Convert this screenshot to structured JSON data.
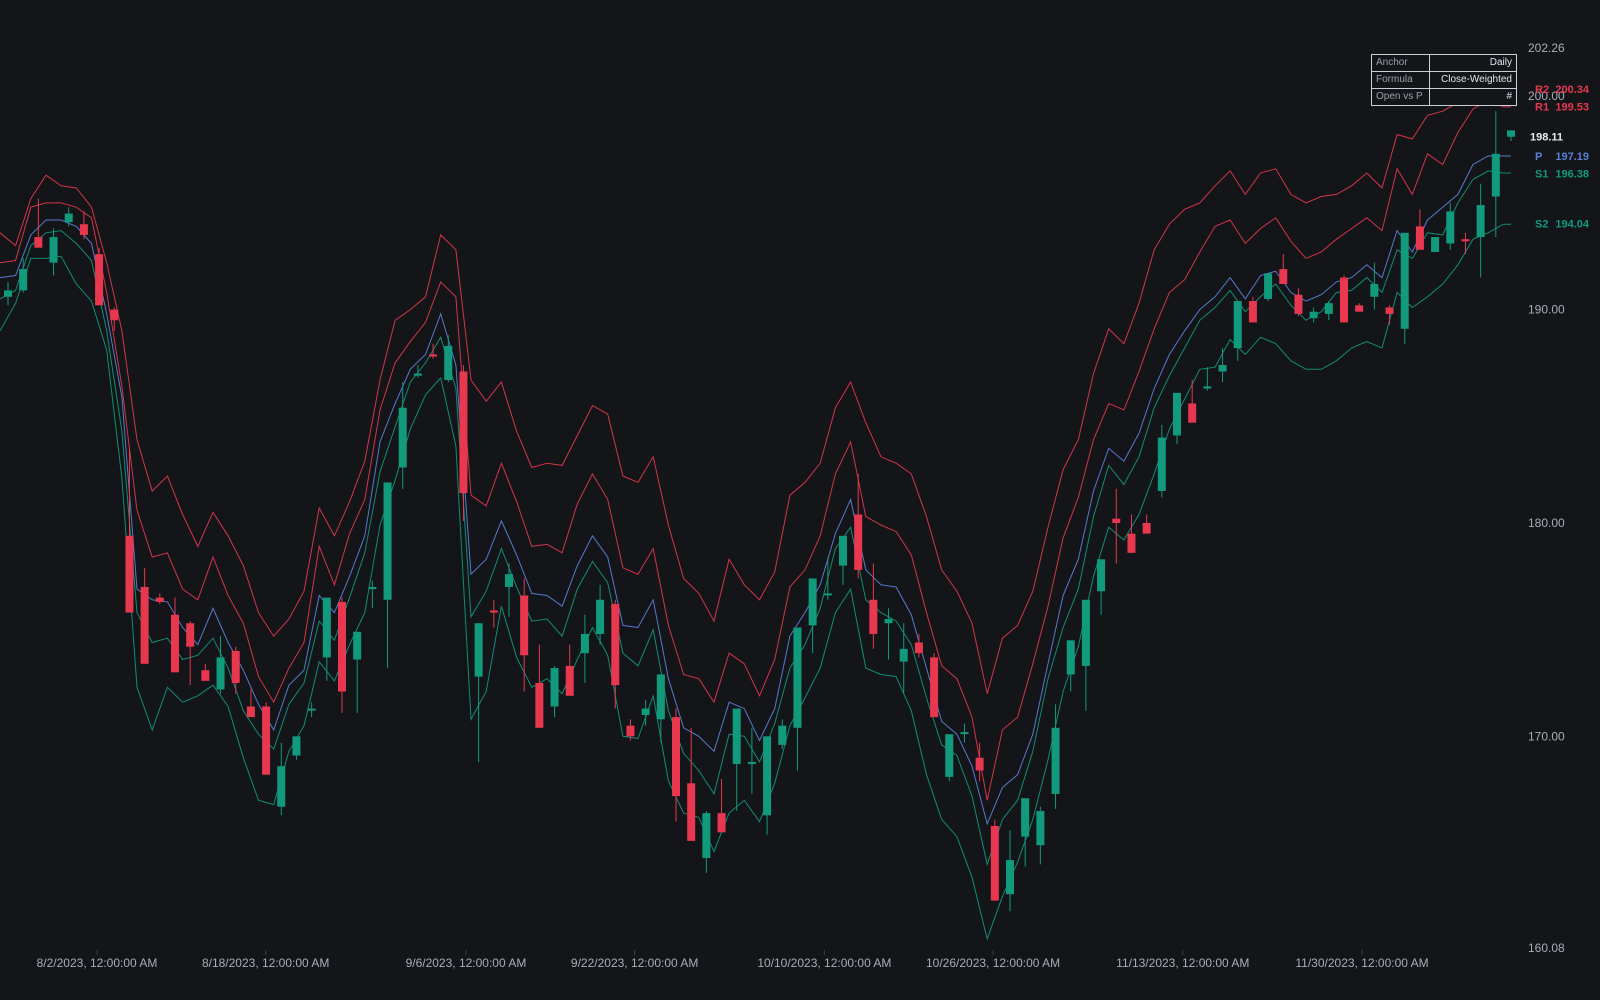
{
  "chart_data": {
    "type": "candlestick",
    "title": "",
    "y_range": [
      160.08,
      202.26
    ],
    "y_ticks": [
      "202.26",
      "200.00",
      "190.00",
      "180.00",
      "170.00",
      "160.08"
    ],
    "x_ticks": [
      {
        "date": "2023-08-02",
        "label": "8/2/2023, 12:00:00 AM"
      },
      {
        "date": "2023-08-18",
        "label": "8/18/2023, 12:00:00 AM"
      },
      {
        "date": "2023-09-06",
        "label": "9/6/2023, 12:00:00 AM"
      },
      {
        "date": "2023-09-22",
        "label": "9/22/2023, 12:00:00 AM"
      },
      {
        "date": "2023-10-10",
        "label": "10/10/2023, 12:00:00 AM"
      },
      {
        "date": "2023-10-26",
        "label": "10/26/2023, 12:00:00 AM"
      },
      {
        "date": "2023-11-13",
        "label": "11/13/2023, 12:00:00 AM"
      },
      {
        "date": "2023-11-30",
        "label": "11/30/2023, 12:00:00 AM"
      }
    ],
    "last_price": "198.11",
    "levels": [
      {
        "name": "R2",
        "value": "200.34",
        "color": "#e8384f"
      },
      {
        "name": "R1",
        "value": "199.53",
        "color": "#e8384f"
      },
      {
        "name": "P",
        "value": "197.19",
        "color": "#5b7fd6"
      },
      {
        "name": "S1",
        "value": "196.38",
        "color": "#129a7d"
      },
      {
        "name": "S2",
        "value": "194.04",
        "color": "#129a7d"
      }
    ],
    "colors": {
      "up": "#129a7d",
      "down": "#e8384f",
      "pivot": "#5b7fd6",
      "resistance": "#e8384f",
      "support": "#129a7d",
      "background": "#131519"
    },
    "candles_ohlc": [
      [
        190.6,
        191.3,
        190.2,
        190.9
      ],
      [
        190.9,
        192.4,
        190.8,
        191.9
      ],
      [
        193.4,
        195.2,
        193.0,
        192.9
      ],
      [
        192.2,
        193.8,
        191.6,
        193.4
      ],
      [
        194.1,
        194.8,
        193.9,
        194.5
      ],
      [
        194.0,
        194.6,
        193.3,
        193.5
      ],
      [
        192.6,
        192.9,
        190.4,
        190.2
      ],
      [
        190.0,
        190.1,
        189.0,
        189.5
      ],
      [
        179.4,
        183.5,
        178.7,
        175.8
      ],
      [
        177.0,
        177.9,
        173.4,
        173.4
      ],
      [
        176.5,
        176.7,
        176.2,
        176.3
      ],
      [
        175.7,
        176.5,
        174.2,
        173.0
      ],
      [
        175.3,
        175.4,
        172.4,
        174.2
      ],
      [
        173.1,
        173.4,
        172.6,
        172.6
      ],
      [
        172.2,
        174.7,
        172.0,
        173.7
      ],
      [
        174.0,
        174.2,
        172.0,
        172.5
      ],
      [
        171.4,
        172.2,
        171.3,
        170.9
      ],
      [
        171.4,
        171.6,
        168.2,
        168.2
      ],
      [
        166.7,
        169.7,
        166.3,
        168.6
      ],
      [
        169.1,
        169.8,
        168.9,
        170.0
      ],
      [
        171.3,
        171.6,
        170.9,
        171.3
      ],
      [
        173.7,
        176.5,
        172.6,
        176.5
      ],
      [
        176.3,
        176.5,
        171.1,
        172.1
      ],
      [
        173.6,
        174.8,
        171.1,
        174.9
      ],
      [
        176.9,
        177.3,
        176.0,
        177.0
      ],
      [
        176.4,
        181.2,
        173.2,
        181.9
      ],
      [
        182.6,
        186.6,
        181.6,
        185.4
      ],
      [
        186.9,
        187.4,
        186.8,
        187.0
      ],
      [
        187.9,
        188.4,
        187.7,
        187.8
      ],
      [
        186.7,
        188.8,
        186.6,
        188.3
      ],
      [
        187.1,
        187.4,
        180.1,
        181.4
      ],
      [
        172.8,
        175.3,
        168.8,
        175.3
      ],
      [
        175.9,
        176.4,
        175.1,
        175.8
      ],
      [
        177.0,
        178.1,
        175.6,
        177.6
      ],
      [
        176.6,
        177.4,
        172.1,
        173.8
      ],
      [
        172.5,
        174.3,
        170.4,
        170.4
      ],
      [
        171.4,
        173.3,
        170.9,
        173.2
      ],
      [
        173.3,
        174.3,
        172.0,
        171.9
      ],
      [
        173.9,
        175.7,
        172.5,
        174.8
      ],
      [
        174.8,
        177.1,
        174.3,
        176.4
      ],
      [
        176.2,
        176.4,
        171.3,
        172.4
      ],
      [
        170.5,
        170.8,
        169.8,
        170.0
      ],
      [
        171.0,
        171.7,
        170.5,
        171.3
      ],
      [
        170.8,
        172.9,
        169.7,
        172.9
      ],
      [
        170.9,
        171.3,
        166.0,
        167.2
      ],
      [
        167.8,
        170.4,
        165.3,
        165.1
      ],
      [
        164.3,
        166.5,
        163.6,
        166.4
      ],
      [
        166.4,
        168.0,
        165.5,
        165.5
      ],
      [
        168.7,
        170.2,
        166.5,
        171.3
      ],
      [
        168.7,
        170.4,
        167.3,
        168.8
      ],
      [
        166.3,
        169.3,
        165.4,
        170.0
      ],
      [
        169.6,
        170.8,
        169.4,
        170.5
      ],
      [
        170.4,
        174.9,
        168.4,
        175.1
      ],
      [
        175.2,
        176.0,
        173.9,
        177.4
      ],
      [
        176.7,
        178.4,
        176.4,
        176.7
      ],
      [
        178.0,
        178.7,
        177.1,
        179.4
      ],
      [
        180.4,
        182.3,
        177.4,
        177.8
      ],
      [
        176.4,
        178.1,
        174.1,
        174.8
      ],
      [
        175.3,
        176.0,
        173.6,
        175.5
      ],
      [
        173.5,
        175.3,
        172.0,
        174.1
      ],
      [
        174.4,
        174.8,
        173.7,
        173.9
      ],
      [
        173.7,
        173.9,
        171.3,
        170.9
      ],
      [
        168.1,
        169.9,
        167.9,
        170.1
      ],
      [
        170.2,
        170.6,
        169.7,
        170.2
      ],
      [
        169.0,
        169.7,
        167.9,
        168.4
      ],
      [
        165.8,
        166.1,
        162.9,
        162.3
      ],
      [
        162.6,
        165.6,
        161.8,
        164.2
      ],
      [
        165.3,
        165.5,
        163.9,
        167.1
      ],
      [
        164.9,
        166.7,
        164.0,
        166.5
      ],
      [
        167.3,
        171.5,
        166.6,
        170.4
      ],
      [
        172.9,
        173.5,
        172.1,
        174.5
      ],
      [
        173.3,
        174.6,
        171.2,
        176.4
      ],
      [
        176.8,
        177.3,
        175.7,
        178.3
      ],
      [
        180.2,
        181.6,
        178.1,
        180.0
      ],
      [
        179.5,
        180.4,
        179.0,
        178.6
      ],
      [
        180.0,
        180.4,
        179.7,
        179.5
      ],
      [
        181.5,
        184.6,
        181.2,
        184.0
      ],
      [
        184.1,
        185.5,
        183.7,
        186.1
      ],
      [
        185.6,
        186.7,
        184.8,
        184.7
      ],
      [
        186.3,
        187.3,
        186.2,
        186.4
      ],
      [
        187.1,
        188.2,
        186.6,
        187.4
      ],
      [
        188.2,
        190.0,
        187.6,
        190.4
      ],
      [
        190.4,
        190.6,
        189.6,
        189.4
      ],
      [
        190.5,
        191.5,
        190.4,
        191.7
      ],
      [
        191.9,
        192.6,
        191.4,
        191.2
      ],
      [
        190.7,
        191.0,
        189.7,
        189.8
      ],
      [
        189.6,
        190.1,
        189.4,
        189.9
      ],
      [
        189.8,
        190.4,
        189.5,
        190.3
      ],
      [
        191.5,
        191.6,
        189.4,
        189.4
      ],
      [
        190.2,
        190.3,
        190.0,
        189.9
      ],
      [
        190.6,
        192.2,
        190.0,
        191.2
      ],
      [
        190.1,
        190.2,
        189.3,
        189.8
      ],
      [
        189.1,
        192.9,
        188.4,
        193.6
      ],
      [
        193.9,
        194.7,
        193.3,
        192.8
      ],
      [
        192.7,
        193.2,
        192.9,
        193.4
      ],
      [
        193.1,
        195.0,
        192.8,
        194.6
      ],
      [
        193.3,
        193.6,
        192.6,
        193.2
      ],
      [
        193.4,
        195.9,
        191.5,
        194.9
      ],
      [
        195.3,
        199.3,
        193.4,
        197.3
      ],
      [
        198.1,
        198.4,
        197.9,
        198.4
      ]
    ],
    "pivot_series": {
      "R2": [
        193.6,
        193.0,
        195.2,
        196.3,
        195.8,
        195.7,
        194.8,
        192.2,
        189.0,
        183.9,
        181.5,
        182.2,
        180.4,
        178.9,
        180.5,
        179.4,
        178.0,
        175.8,
        174.7,
        175.5,
        176.8,
        180.7,
        179.4,
        181.0,
        182.9,
        186.7,
        189.5,
        190.0,
        190.6,
        193.5,
        192.8,
        186.7,
        185.7,
        186.6,
        184.3,
        182.6,
        182.8,
        182.7,
        184.1,
        185.5,
        185.1,
        182.2,
        181.9,
        183.1,
        179.9,
        177.4,
        176.7,
        175.4,
        178.3,
        177.1,
        176.4,
        177.7,
        181.3,
        181.9,
        182.8,
        185.4,
        186.6,
        184.7,
        183.1,
        182.8,
        182.3,
        180.3,
        177.8,
        176.8,
        175.3,
        172.0,
        174.6,
        175.2,
        176.8,
        179.8,
        182.5,
        183.9,
        187.0,
        189.1,
        188.4,
        190.3,
        192.8,
        194.0,
        194.7,
        195.0,
        195.8,
        196.5,
        195.4,
        196.4,
        196.6,
        195.4,
        195.0,
        195.3,
        195.4,
        195.8,
        196.4,
        195.7,
        198.2,
        198.0,
        199.1,
        199.3,
        199.7,
        200.7,
        201.5,
        200.3
      ],
      "R1": [
        192.2,
        192.3,
        194.8,
        195.0,
        195.0,
        194.8,
        194.3,
        190.8,
        186.4,
        180.6,
        178.4,
        178.6,
        176.9,
        176.4,
        178.4,
        176.6,
        175.3,
        172.8,
        171.6,
        173.2,
        174.4,
        178.9,
        177.1,
        179.5,
        181.1,
        185.3,
        187.5,
        188.5,
        189.4,
        191.3,
        190.6,
        181.3,
        180.8,
        182.8,
        181.0,
        178.9,
        179.0,
        178.6,
        180.9,
        182.3,
        181.1,
        177.9,
        177.6,
        178.8,
        175.2,
        172.9,
        172.7,
        171.6,
        173.9,
        173.4,
        171.9,
        173.6,
        177.0,
        177.8,
        179.4,
        182.3,
        183.8,
        180.3,
        179.9,
        179.6,
        178.5,
        175.8,
        173.3,
        172.7,
        170.9,
        167.0,
        170.3,
        170.9,
        173.4,
        176.1,
        179.3,
        181.2,
        183.9,
        185.6,
        185.3,
        187.1,
        189.1,
        190.8,
        191.4,
        192.7,
        193.9,
        194.2,
        193.1,
        193.8,
        194.3,
        193.2,
        192.4,
        192.7,
        193.3,
        193.8,
        194.3,
        193.7,
        196.6,
        195.4,
        197.3,
        196.8,
        198.3,
        199.4,
        199.8,
        199.5
      ],
      "P": [
        191.5,
        191.6,
        193.5,
        194.2,
        194.2,
        193.9,
        193.1,
        189.8,
        185.9,
        176.9,
        176.4,
        176.3,
        175.1,
        174.3,
        176.0,
        174.4,
        173.1,
        171.5,
        170.3,
        172.4,
        173.1,
        176.6,
        175.8,
        177.5,
        179.4,
        183.8,
        185.6,
        187.2,
        187.9,
        189.8,
        187.4,
        177.6,
        178.3,
        180.1,
        178.5,
        176.7,
        176.6,
        176.1,
        178.0,
        179.4,
        178.4,
        175.2,
        175.1,
        176.4,
        172.7,
        170.4,
        170.0,
        169.3,
        171.6,
        171.3,
        169.8,
        171.3,
        174.7,
        175.8,
        177.1,
        179.5,
        181.1,
        177.8,
        177.1,
        177.0,
        175.7,
        173.2,
        170.7,
        170.1,
        168.6,
        165.9,
        167.6,
        168.2,
        170.1,
        173.4,
        176.6,
        178.3,
        181.5,
        183.5,
        182.9,
        184.2,
        186.3,
        187.9,
        189.0,
        190.0,
        190.6,
        191.5,
        190.5,
        191.6,
        191.8,
        190.8,
        190.4,
        190.7,
        191.3,
        191.5,
        192.1,
        191.5,
        193.7,
        192.7,
        194.2,
        194.8,
        195.4,
        196.8,
        197.2,
        197.2
      ],
      "S1": [
        190.5,
        190.9,
        193.0,
        193.6,
        193.7,
        193.1,
        192.3,
        189.0,
        184.3,
        175.8,
        174.4,
        174.6,
        173.6,
        173.8,
        174.6,
        173.2,
        171.2,
        170.1,
        169.4,
        171.5,
        172.5,
        175.4,
        174.5,
        176.5,
        178.6,
        182.4,
        184.5,
        186.6,
        187.5,
        188.7,
        186.3,
        175.6,
        176.8,
        178.8,
        177.0,
        175.4,
        175.5,
        174.7,
        176.9,
        178.2,
        177.2,
        173.9,
        173.3,
        175.0,
        171.2,
        169.2,
        168.4,
        167.3,
        170.1,
        170.0,
        168.8,
        170.6,
        173.2,
        174.3,
        176.0,
        178.8,
        179.8,
        176.4,
        175.8,
        175.4,
        174.3,
        171.8,
        169.6,
        169.1,
        167.2,
        164.0,
        166.1,
        167.0,
        169.3,
        172.7,
        175.1,
        176.9,
        180.3,
        182.7,
        181.8,
        183.1,
        185.4,
        186.9,
        188.2,
        189.5,
        190.1,
        190.9,
        189.9,
        190.6,
        191.2,
        190.2,
        189.5,
        189.9,
        190.8,
        190.9,
        191.5,
        190.8,
        192.8,
        192.4,
        193.6,
        193.5,
        195.0,
        196.1,
        196.5,
        196.4
      ],
      "S2": [
        189.0,
        190.3,
        192.4,
        192.4,
        192.5,
        191.2,
        190.4,
        188.1,
        182.1,
        172.3,
        170.3,
        172.3,
        171.6,
        171.9,
        172.4,
        171.4,
        169.0,
        167.0,
        166.8,
        169.3,
        170.5,
        173.5,
        172.6,
        174.3,
        175.8,
        179.9,
        182.0,
        184.4,
        186.0,
        186.8,
        183.6,
        170.8,
        172.1,
        176.1,
        173.7,
        172.3,
        172.7,
        172.0,
        173.6,
        175.1,
        173.8,
        170.0,
        169.9,
        171.9,
        167.9,
        166.4,
        166.2,
        164.6,
        166.4,
        167.0,
        166.0,
        167.8,
        170.5,
        171.8,
        173.2,
        175.8,
        176.9,
        173.2,
        172.9,
        172.8,
        171.2,
        168.2,
        166.1,
        165.3,
        163.4,
        160.5,
        162.5,
        164.1,
        166.1,
        168.9,
        172.1,
        174.2,
        177.5,
        179.8,
        179.2,
        180.4,
        182.3,
        184.4,
        185.8,
        187.2,
        187.3,
        188.6,
        187.9,
        188.7,
        188.4,
        187.6,
        187.2,
        187.2,
        187.6,
        188.2,
        188.5,
        188.2,
        190.8,
        190.1,
        190.6,
        191.2,
        192.1,
        193.3,
        193.6,
        194.0
      ]
    }
  },
  "info_table": {
    "rows": [
      {
        "label": "Anchor",
        "value": "Daily"
      },
      {
        "label": "Formula",
        "value": "Close-Weighted"
      },
      {
        "label": "Open vs P",
        "value": "#"
      }
    ]
  }
}
